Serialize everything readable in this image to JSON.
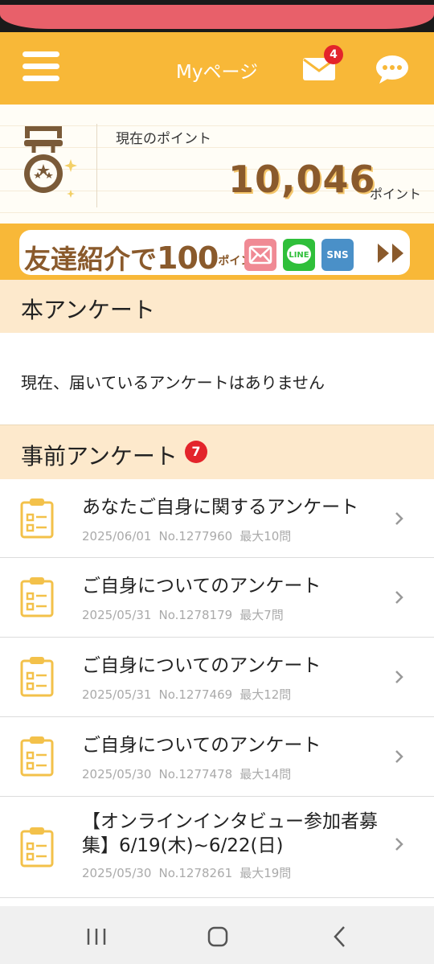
{
  "header": {
    "title": "Myページ",
    "mail_badge": "4"
  },
  "points": {
    "label": "現在のポイント",
    "value": "10,046",
    "unit": "ポイント"
  },
  "invite_banner": {
    "text_main": "友達紹介で",
    "text_amount": "100",
    "text_unit": "ポイント",
    "share_options": [
      "mail",
      "LINE",
      "SNS"
    ]
  },
  "main_survey": {
    "title": "本アンケート",
    "empty_message": "現在、届いているアンケートはありません"
  },
  "pre_survey": {
    "title": "事前アンケート",
    "badge": "7",
    "items": [
      {
        "title": "あなたご自身に関するアンケート",
        "date": "2025/06/01",
        "number": "No.1277960",
        "max_questions": "最大10問"
      },
      {
        "title": "ご自身についてのアンケート",
        "date": "2025/05/31",
        "number": "No.1278179",
        "max_questions": "最大7問"
      },
      {
        "title": "ご自身についてのアンケート",
        "date": "2025/05/31",
        "number": "No.1277469",
        "max_questions": "最大12問"
      },
      {
        "title": "ご自身についてのアンケート",
        "date": "2025/05/30",
        "number": "No.1277478",
        "max_questions": "最大14問"
      },
      {
        "title": "【オンラインインタビュー参加者募集】6/19(木)~6/22(日)",
        "date": "2025/05/30",
        "number": "No.1278261",
        "max_questions": "最大19問"
      }
    ]
  },
  "icons": {
    "menu": "hamburger-icon",
    "mail": "envelope-icon",
    "chat": "chat-bubble-icon",
    "medal": "medal-icon",
    "survey": "clipboard-icon",
    "chevron": "chevron-right-icon"
  },
  "colors": {
    "brand": "#f8b838",
    "section_bg": "#fde9cc",
    "badge": "#e3242b",
    "points_text": "#8a5a2c",
    "line_green": "#2fbf3a",
    "mail_pink": "#f08a94",
    "sns_blue": "#4a90c8"
  }
}
